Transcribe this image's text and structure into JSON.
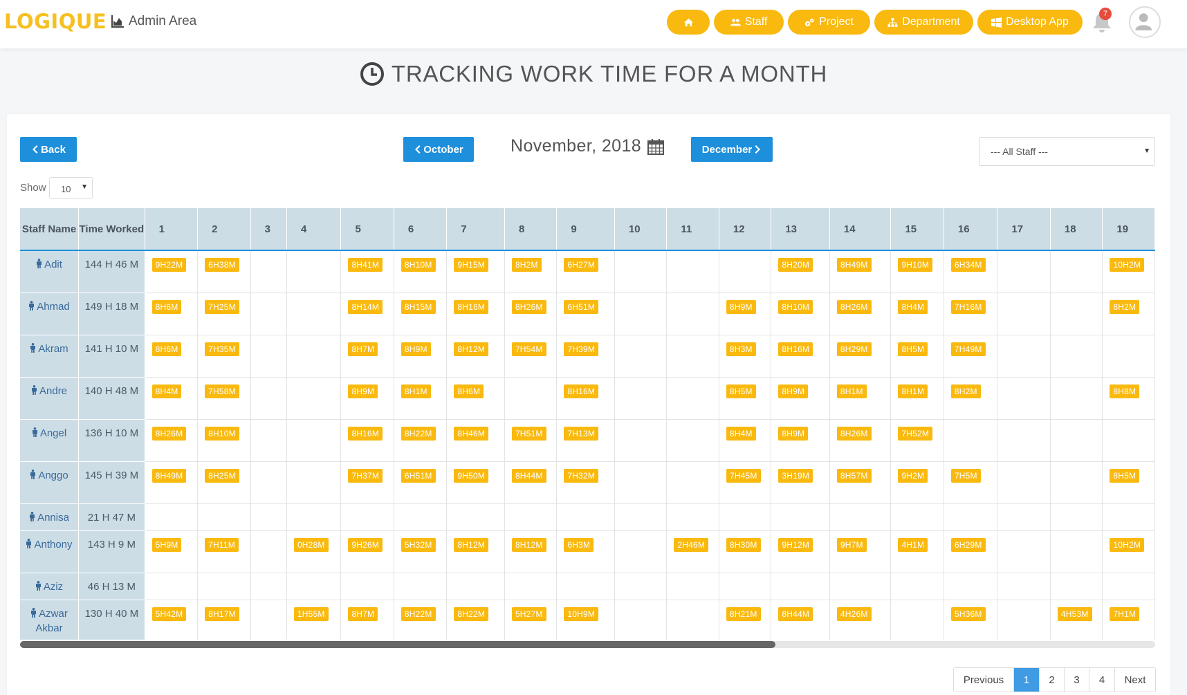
{
  "header": {
    "logo": "LOGIQUE",
    "area": "Admin Area",
    "nav": [
      "",
      "Staff",
      "Project",
      "Department",
      "Desktop App"
    ],
    "notifications": "7"
  },
  "page": {
    "title": "TRACKING WORK TIME FOR A MONTH",
    "back": "Back",
    "prev_month": "October",
    "current_month": "November, 2018",
    "next_month": "December",
    "staff_filter": "--- All Staff ---",
    "show_label": "Show",
    "show_value": "10"
  },
  "table": {
    "col_staff": "Staff Name",
    "col_worked": "Time Worked",
    "days": [
      "1",
      "2",
      "3",
      "4",
      "5",
      "6",
      "7",
      "8",
      "9",
      "10",
      "11",
      "12",
      "13",
      "14",
      "15",
      "16",
      "17",
      "18",
      "19"
    ],
    "rows": [
      {
        "name": "Adit",
        "worked": "144 H 46 M",
        "cells": [
          "9H22M",
          "6H38M",
          "",
          "",
          "8H41M",
          "8H10M",
          "9H15M",
          "8H2M",
          "6H27M",
          "",
          "",
          "",
          "8H20M",
          "8H49M",
          "9H10M",
          "6H34M",
          "",
          "",
          "10H2M"
        ]
      },
      {
        "name": "Ahmad",
        "worked": "149 H 18 M",
        "cells": [
          "8H6M",
          "7H25M",
          "",
          "",
          "8H14M",
          "8H15M",
          "8H16M",
          "8H26M",
          "6H51M",
          "",
          "",
          "8H9M",
          "8H10M",
          "8H26M",
          "8H4M",
          "7H16M",
          "",
          "",
          "8H2M"
        ]
      },
      {
        "name": "Akram",
        "worked": "141 H 10 M",
        "cells": [
          "8H6M",
          "7H35M",
          "",
          "",
          "8H7M",
          "8H9M",
          "8H12M",
          "7H54M",
          "7H39M",
          "",
          "",
          "8H3M",
          "8H16M",
          "8H29M",
          "8H5M",
          "7H49M",
          "",
          "",
          ""
        ]
      },
      {
        "name": "Andre",
        "worked": "140 H 48 M",
        "cells": [
          "8H4M",
          "7H58M",
          "",
          "",
          "8H9M",
          "8H1M",
          "8H6M",
          "",
          "8H16M",
          "",
          "",
          "8H5M",
          "8H9M",
          "8H1M",
          "8H1M",
          "8H2M",
          "",
          "",
          "8H8M"
        ]
      },
      {
        "name": "Angel",
        "worked": "136 H 10 M",
        "cells": [
          "8H26M",
          "8H10M",
          "",
          "",
          "8H16M",
          "8H22M",
          "8H46M",
          "7H51M",
          "7H13M",
          "",
          "",
          "8H4M",
          "8H9M",
          "8H26M",
          "7H52M",
          "",
          "",
          "",
          ""
        ]
      },
      {
        "name": "Anggo",
        "worked": "145 H 39 M",
        "cells": [
          "8H49M",
          "8H25M",
          "",
          "",
          "7H37M",
          "6H51M",
          "9H50M",
          "8H44M",
          "7H32M",
          "",
          "",
          "7H45M",
          "3H19M",
          "8H57M",
          "9H2M",
          "7H5M",
          "",
          "",
          "8H5M"
        ]
      },
      {
        "name": "Annisa",
        "worked": "21 H 47 M",
        "cells": [
          "",
          "",
          "",
          "",
          "",
          "",
          "",
          "",
          "",
          "",
          "",
          "",
          "",
          "",
          "",
          "",
          "",
          "",
          ""
        ]
      },
      {
        "name": "Anthony",
        "worked": "143 H 9 M",
        "cells": [
          "5H9M",
          "7H11M",
          "",
          "0H28M",
          "9H26M",
          "5H32M",
          "8H12M",
          "8H12M",
          "6H3M",
          "",
          "2H46M",
          "8H30M",
          "9H12M",
          "9H7M",
          "4H1M",
          "6H29M",
          "",
          "",
          "10H2M"
        ]
      },
      {
        "name": "Aziz",
        "worked": "46 H 13 M",
        "cells": [
          "",
          "",
          "",
          "",
          "",
          "",
          "",
          "",
          "",
          "",
          "",
          "",
          "",
          "",
          "",
          "",
          "",
          "",
          ""
        ]
      },
      {
        "name": "Azwar Akbar",
        "worked": "130 H 40 M",
        "cells": [
          "5H42M",
          "8H17M",
          "",
          "1H55M",
          "8H7M",
          "8H22M",
          "8H22M",
          "5H27M",
          "10H9M",
          "",
          "",
          "8H21M",
          "8H44M",
          "4H26M",
          "",
          "5H36M",
          "",
          "4H53M",
          "7H1M"
        ]
      }
    ]
  },
  "pagination": {
    "prev": "Previous",
    "pages": [
      "1",
      "2",
      "3",
      "4"
    ],
    "next": "Next",
    "active": "1"
  },
  "colors": {
    "accent": "#f9b90f",
    "primary": "#1d8fdb",
    "header_bg": "#cddde6"
  }
}
